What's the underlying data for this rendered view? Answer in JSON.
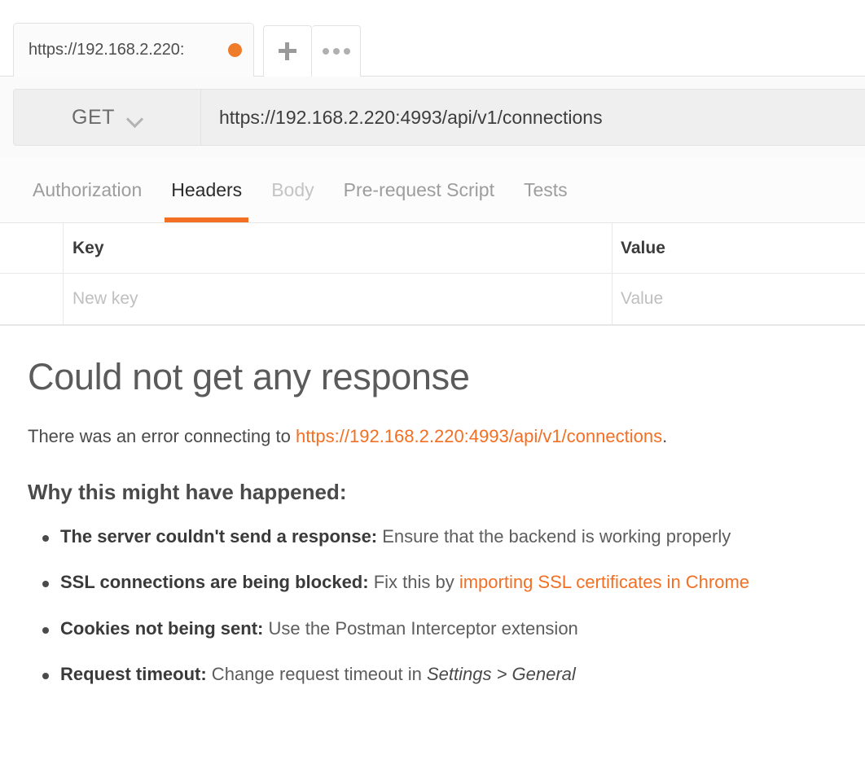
{
  "tabstrip": {
    "active_tab_label": "https://192.168.2.220:",
    "unsaved_dot": "unsaved-indicator",
    "new_tab_label": "+",
    "more_label": "•••"
  },
  "request": {
    "method": "GET",
    "url": "https://192.168.2.220:4993/api/v1/connections",
    "tabs": [
      {
        "label": "Authorization",
        "state": "normal"
      },
      {
        "label": "Headers",
        "state": "active"
      },
      {
        "label": "Body",
        "state": "dim"
      },
      {
        "label": "Pre-request Script",
        "state": "normal"
      },
      {
        "label": "Tests",
        "state": "normal"
      }
    ]
  },
  "headers_table": {
    "columns": [
      "Key",
      "Value"
    ],
    "new_row": {
      "key_placeholder": "New key",
      "value_placeholder": "Value"
    }
  },
  "error": {
    "title": "Could not get any response",
    "subtitle_prefix": "There was an error connecting to ",
    "subtitle_link": "https://192.168.2.220:4993/api/v1/connections",
    "subtitle_suffix": ".",
    "why_heading": "Why this might have happened:",
    "reasons": [
      {
        "label": "The server couldn't send a response:",
        "text": " Ensure that the backend is working properly",
        "link": "",
        "tail": "",
        "italic": ""
      },
      {
        "label": "SSL connections are being blocked:",
        "text": " Fix this by ",
        "link": "importing SSL certificates in Chrome",
        "tail": "",
        "italic": ""
      },
      {
        "label": "Cookies not being sent:",
        "text": " Use the Postman Interceptor extension",
        "link": "",
        "tail": "",
        "italic": ""
      },
      {
        "label": "Request timeout:",
        "text": " Change request timeout in ",
        "link": "",
        "italic": "Settings > General",
        "tail": ""
      }
    ]
  },
  "colors": {
    "accent_orange": "#f26f23",
    "tab_dot_orange": "#ef7c2b",
    "text_dark": "#3a3a3a",
    "text_muted": "#9d9d9d"
  }
}
